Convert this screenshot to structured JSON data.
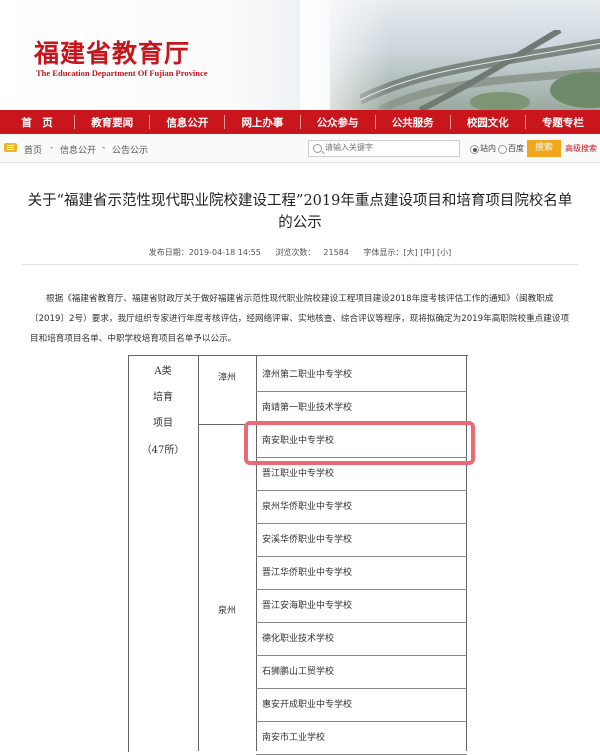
{
  "header": {
    "logo_cn": "福建省教育厅",
    "logo_en": "The Education Department Of Fujian Province"
  },
  "nav": [
    {
      "label": "首　页"
    },
    {
      "label": "教育要闻"
    },
    {
      "label": "信息公开"
    },
    {
      "label": "网上办事"
    },
    {
      "label": "公众参与"
    },
    {
      "label": "公共服务"
    },
    {
      "label": "校园文化"
    },
    {
      "label": "专题专栏"
    }
  ],
  "breadcrumb": {
    "home": "首页",
    "sep1": "-",
    "section": "信息公开",
    "sep2": "-",
    "page": "公告公示"
  },
  "search": {
    "placeholder": "请输入关键字",
    "option_site": "站内",
    "option_baidu": "百度",
    "button": "搜索",
    "advanced": "高级搜索"
  },
  "article": {
    "title": "关于“福建省示范性现代职业院校建设工程”2019年重点建设项目和培育项目院校名单的公示",
    "publish_label": "发布日期：2019-04-18 14:55",
    "views_label": "浏览次数：",
    "views": "21584",
    "font_label": "字体显示：[大] [中] [小]",
    "body": "根据《福建省教育厅、福建省财政厅关于做好福建省示范性现代职业院校建设工程项目建设2018年度考核评估工作的通知》（闽教职成〔2019〕2号）要求，我厅组织专家进行年度考核评估，经网络评审、实地核查、综合评议等程序，现将拟确定为2019年高职院校重点建设项目和培育项目名单、中职学校培育项目名单予以公示。"
  },
  "table": {
    "category": {
      "line1": "A类",
      "line2": "培育",
      "line3": "项目",
      "count": "（47所）"
    },
    "cities": {
      "zhangzhou": "漳州",
      "quanzhou": "泉州"
    },
    "schools": [
      "漳州第二职业中专学校",
      "南靖第一职业技术学校",
      "南安职业中专学校",
      "晋江职业中专学校",
      "泉州华侨职业中专学校",
      "安溪华侨职业中专学校",
      "晋江华侨职业中专学校",
      "晋江安海职业中专学校",
      "德化职业技术学校",
      "石狮鹏山工贸学校",
      "惠安开成职业中专学校",
      "南安市工业学校"
    ],
    "highlighted_index": 2
  },
  "colors": {
    "brand_red": "#c9161c",
    "search_orange": "#f3a51c",
    "highlight": "#ea6a76"
  }
}
